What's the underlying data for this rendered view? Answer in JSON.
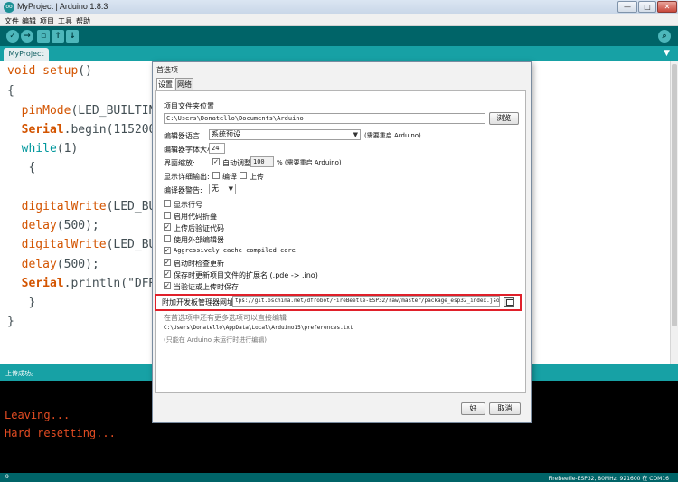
{
  "window": {
    "app_icon": "oo",
    "title": "MyProject | Arduino 1.8.3",
    "min_symbol": "—",
    "max_symbol": "□",
    "close_symbol": "✕"
  },
  "menu": [
    "文件",
    "编辑",
    "项目",
    "工具",
    "帮助"
  ],
  "toolbar": {
    "verify_icon": "✓",
    "upload_icon": "→",
    "new_icon": "▫",
    "open_icon": "↑",
    "save_icon": "↓",
    "serial_icon": "⌕"
  },
  "tab": {
    "label": "MyProject",
    "menu_icon": "▼"
  },
  "code": {
    "l1_kw": "void",
    "l1_fn": " setup",
    "l1_rest": "()",
    "l2": "{",
    "l3_fn": "  pinMode",
    "l3_rest": "(LED_BUILTIN,",
    "l4_obj": "  Serial",
    "l4_rest": ".begin(115200);",
    "l5_kw": "  while",
    "l5_rest": "(1)",
    "l6": "   {",
    "l7_fn": "  digitalWrite",
    "l7_rest": "(LED_BUI",
    "l8_fn": "  delay",
    "l8_rest": "(500);",
    "l9_fn": "  digitalWrite",
    "l9_rest": "(LED_BUI",
    "l10_fn": "  delay",
    "l10_rest": "(500);",
    "l11_obj": "  Serial",
    "l11_rest": ".println(\"DFRo",
    "l12": "   }",
    "l13": "}"
  },
  "status": {
    "text": "上传成功。"
  },
  "console": {
    "line1": "Leaving...",
    "line2": "Hard resetting..."
  },
  "bottom": {
    "line_number": "9",
    "board": "FireBeetle-ESP32, 80MHz, 921600 在 COM16"
  },
  "dialog": {
    "title": "首选项",
    "tabs": [
      "设置",
      "网络"
    ],
    "sketchbook_label": "项目文件夹位置",
    "sketchbook_path": "C:\\Users\\Donatello\\Documents\\Arduino",
    "browse_label": "浏览",
    "language_label": "编辑器语言",
    "language_value": "系统预设",
    "language_note": "(需要重启 Arduino)",
    "fontsize_label": "编辑器字体大小",
    "fontsize_value": "24",
    "scale_label": "界面缩放:",
    "scale_auto": "自动调整",
    "scale_value": "100",
    "scale_note": "% (需要重启 Arduino)",
    "verbose_label": "显示详细输出:",
    "verbose_compile": "编译",
    "verbose_upload": "上传",
    "warnings_label": "编译器警告:",
    "warnings_value": "无",
    "options": [
      {
        "label": "显示行号",
        "checked": false
      },
      {
        "label": "启用代码折叠",
        "checked": false
      },
      {
        "label": "上传后验证代码",
        "checked": true
      },
      {
        "label": "使用外部编辑器",
        "checked": false
      },
      {
        "label": "Aggressively cache compiled core",
        "checked": true
      },
      {
        "label": "启动时检查更新",
        "checked": true
      },
      {
        "label": "保存时更新项目文件的扩展名 (.pde -> .ino)",
        "checked": true
      },
      {
        "label": "当验证或上传时保存",
        "checked": true
      }
    ],
    "boards_url_label": "附加开发板管理器网址:",
    "boards_url_value": "tps://git.oschina.net/dfrobot/FireBeetle-ESP32/raw/master/package_esp32_index.json",
    "more_prefs_note": "在首选项中还有更多选项可以直接编辑",
    "prefs_path": "C:\\Users\\Donatello\\AppData\\Local\\Arduino15\\preferences.txt",
    "prefs_edit_note": "(只能在 Arduino 未运行时进行编辑)",
    "ok_label": "好",
    "cancel_label": "取消",
    "check_mark": "✓"
  }
}
